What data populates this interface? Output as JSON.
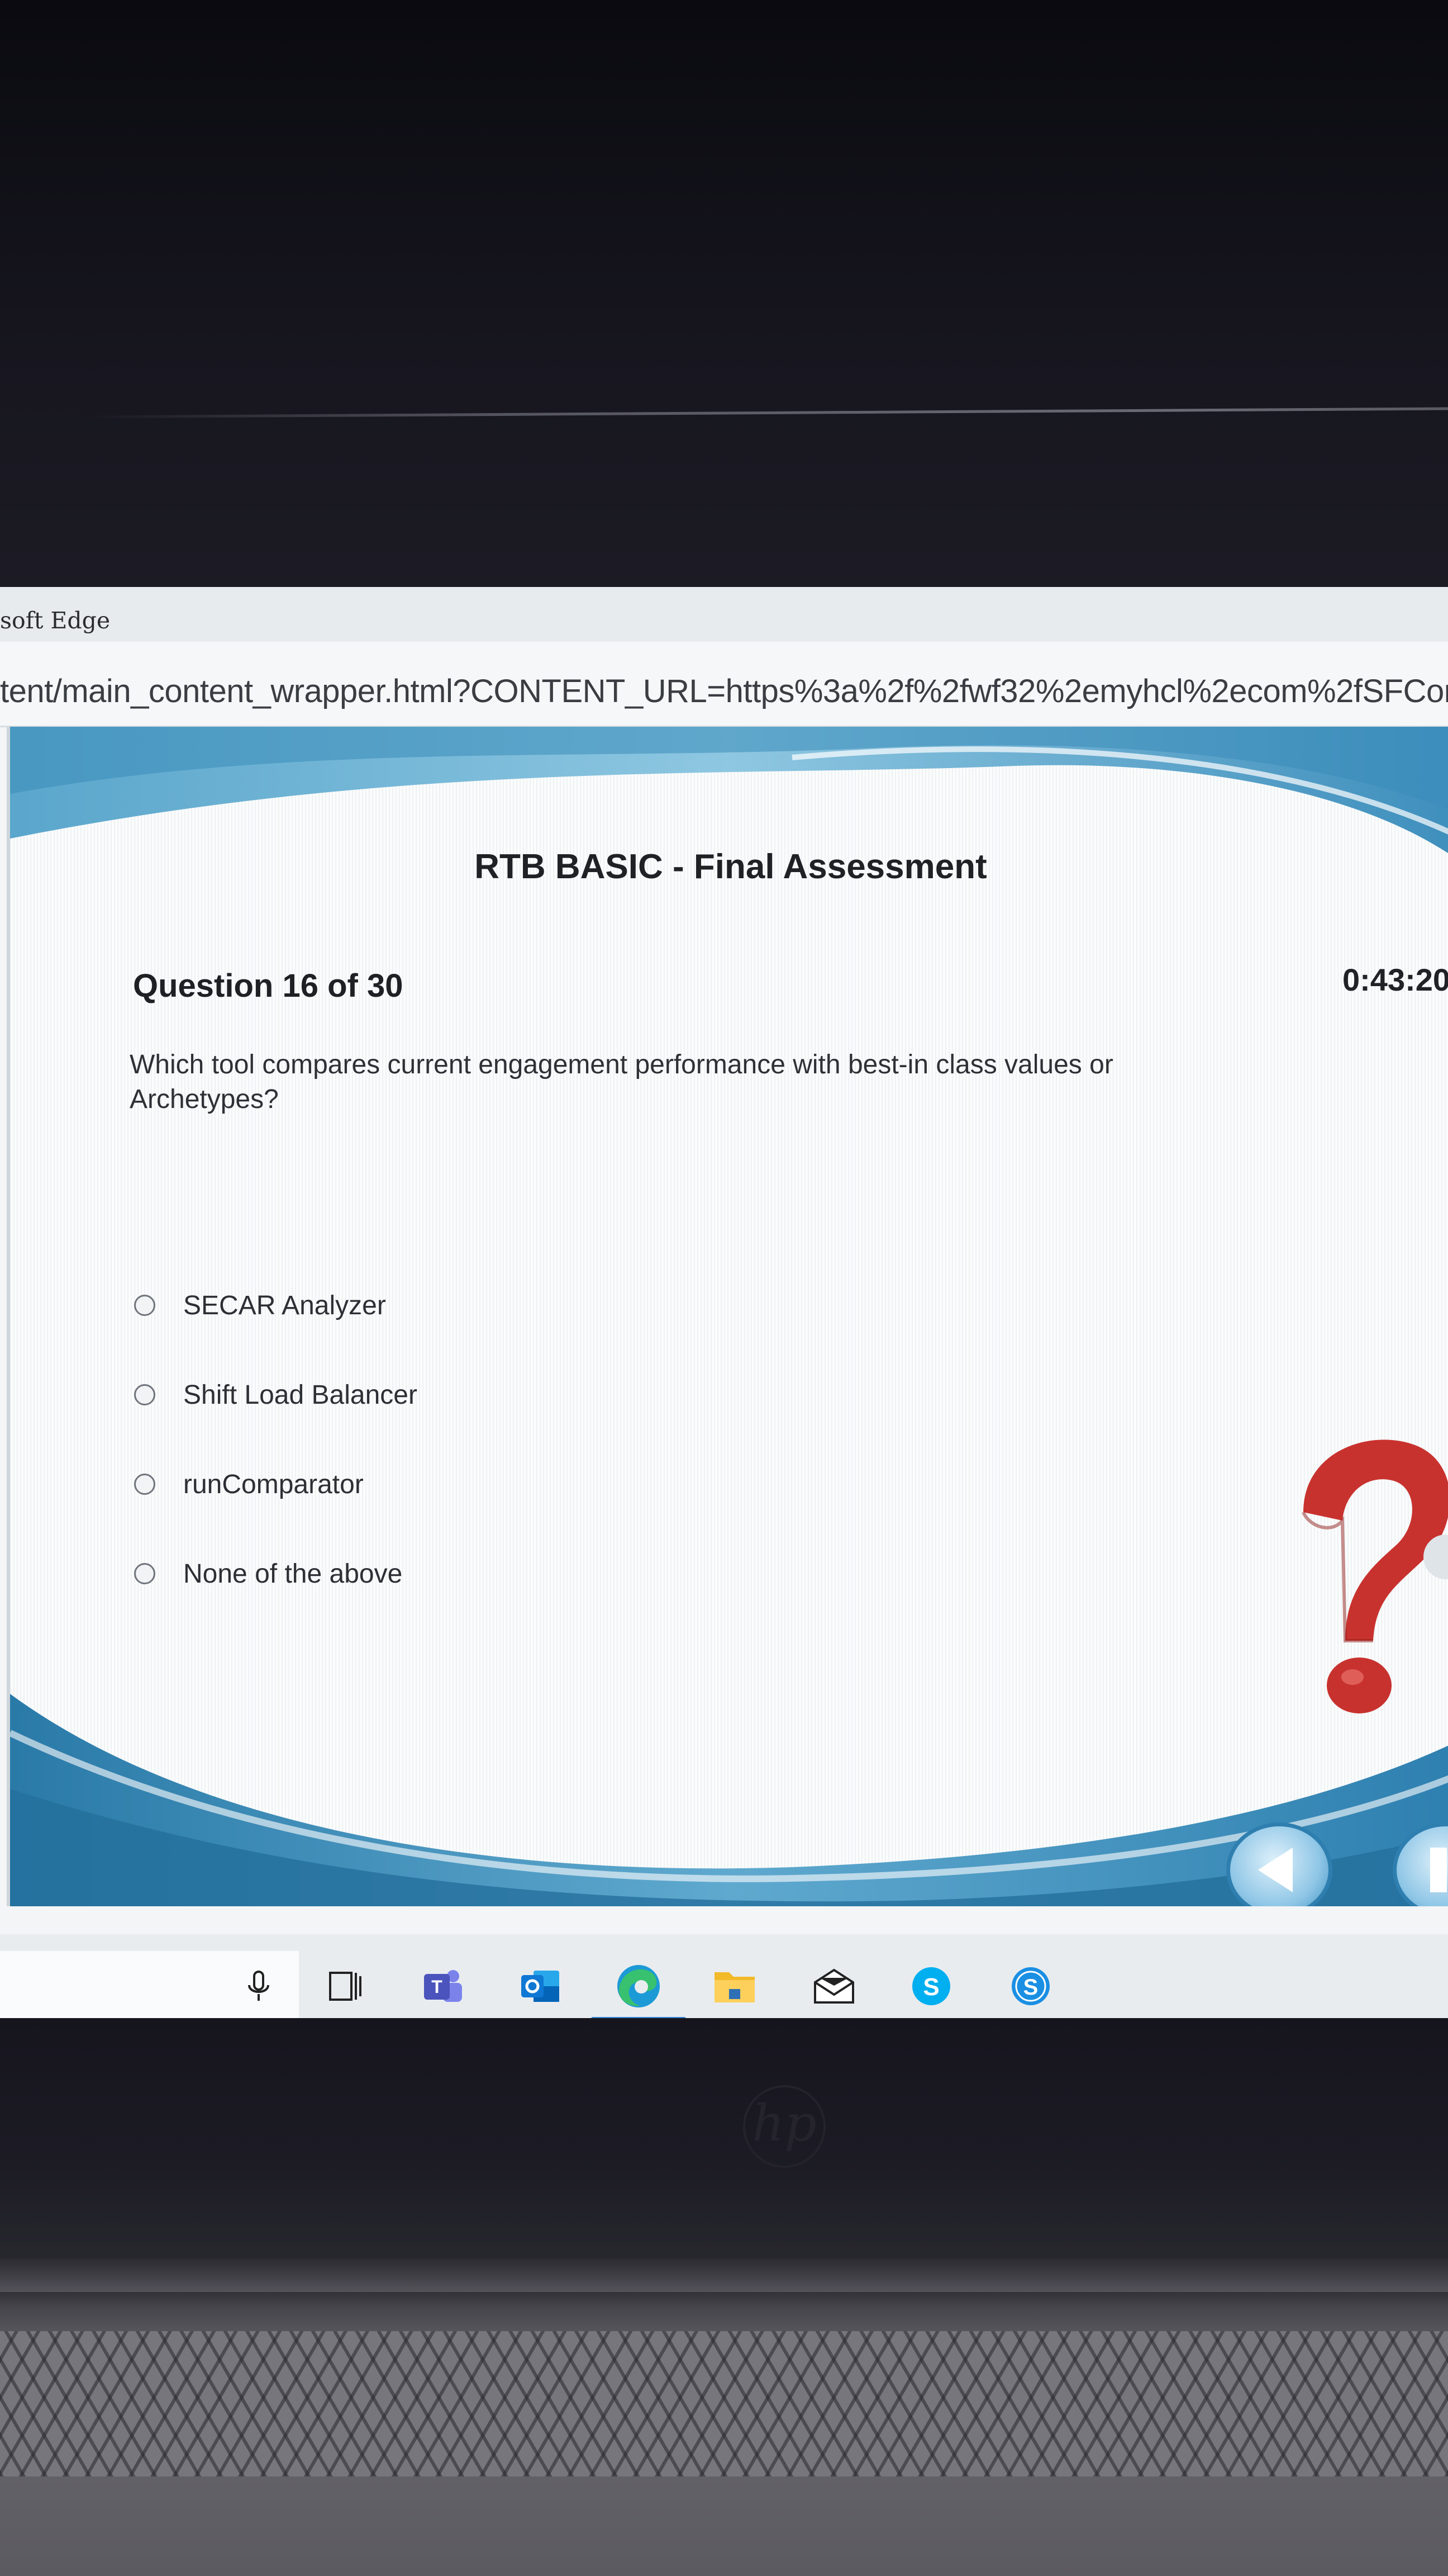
{
  "browser": {
    "window_title": "soft Edge",
    "url": "tent/main_content_wrapper.html?CONTENT_URL=https%3a%2f%2fwf32%2emyhcl%2ecom%2fSFConte"
  },
  "assessment": {
    "title": "RTB BASIC - Final Assessment",
    "question_counter": "Question 16 of 30",
    "timer": "0:43:20",
    "question": "Which tool compares current engagement performance with best-in class values or Archetypes?",
    "options": [
      {
        "label": "SECAR Analyzer",
        "selected": false
      },
      {
        "label": "Shift Load Balancer",
        "selected": false
      },
      {
        "label": "runComparator",
        "selected": false
      },
      {
        "label": "None of the above",
        "selected": false
      }
    ]
  },
  "taskbar": {
    "icons": [
      "microphone-icon",
      "task-view-icon",
      "teams-icon",
      "outlook-icon",
      "edge-icon",
      "file-explorer-icon",
      "mail-icon",
      "skype-icon",
      "skype-for-business-icon"
    ],
    "active": "edge-icon"
  },
  "colors": {
    "accent_blue": "#3a8fc0",
    "wave_dark": "#2d7ca8",
    "question_mark_red": "#c8322e"
  }
}
